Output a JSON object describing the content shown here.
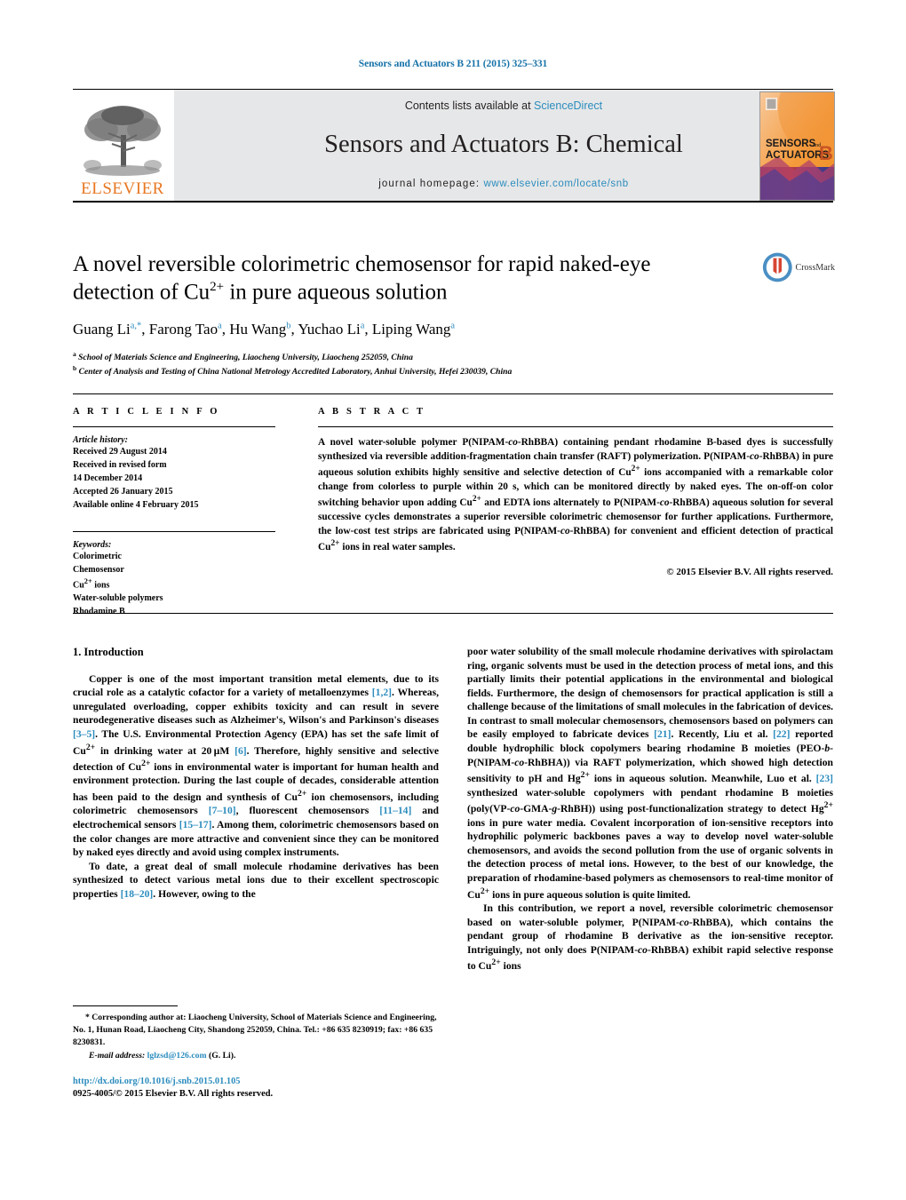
{
  "running_head": "Sensors and Actuators B 211 (2015) 325–331",
  "masthead": {
    "contents_prefix": "Contents lists available at ",
    "sciencedirect": "ScienceDirect",
    "journal_title": "Sensors and Actuators B: Chemical",
    "homepage_prefix": "journal homepage: ",
    "homepage_url": "www.elsevier.com/locate/snb",
    "publisher": "ELSEVIER",
    "cover_line1": "SENSORS",
    "cover_and": "and",
    "cover_line2": "ACTUATORS",
    "cover_letter": "B",
    "accent_color": "#2b8cbe",
    "elsevier_orange": "#E87722"
  },
  "crossmark": {
    "label": "CrossMark"
  },
  "title": {
    "line1": "A novel reversible colorimetric chemosensor for rapid naked-eye",
    "line2_pre": "detection of Cu",
    "line2_sup": "2+",
    "line2_post": " in pure aqueous solution"
  },
  "authors": {
    "list": "Guang Li a,*, Farong Tao a, Hu Wang b, Yuchao Li a, Liping Wang a",
    "affiliation_a": "School of Materials Science and Engineering, Liaocheng University, Liaocheng 252059, China",
    "affiliation_b": "Center of Analysis and Testing of China National Metrology Accredited Laboratory, Anhui University, Hefei 230039, China"
  },
  "article_info": {
    "heading": "A R T I C L E   I N F O",
    "history_label": "Article history:",
    "history": [
      "Received 29 August 2014",
      "Received in revised form",
      "14 December 2014",
      "Accepted 26 January 2015",
      "Available online 4 February 2015"
    ],
    "keywords_label": "Keywords:",
    "keywords": [
      "Colorimetric",
      "Chemosensor",
      "Cu2+ ions",
      "Water-soluble polymers",
      "Rhodamine B"
    ]
  },
  "abstract": {
    "heading": "A B S T R A C T",
    "text": "A novel water-soluble polymer P(NIPAM-co-RhBBA) containing pendant rhodamine B-based dyes is successfully synthesized via reversible addition-fragmentation chain transfer (RAFT) polymerization. P(NIPAM-co-RhBBA) in pure aqueous solution exhibits highly sensitive and selective detection of Cu2+ ions accompanied with a remarkable color change from colorless to purple within 20 s, which can be monitored directly by naked eyes. The on-off-on color switching behavior upon adding Cu2+ and EDTA ions alternately to P(NIPAM-co-RhBBA) aqueous solution for several successive cycles demonstrates a superior reversible colorimetric chemosensor for further applications. Furthermore, the low-cost test strips are fabricated using P(NIPAM-co-RhBBA) for convenient and efficient detection of practical Cu2+ ions in real water samples.",
    "copyright": "© 2015 Elsevier B.V. All rights reserved."
  },
  "body": {
    "section_heading": "1.  Introduction",
    "left_paragraph_1": "Copper is one of the most important transition metal elements, due to its crucial role as a catalytic cofactor for a variety of metalloenzymes [1,2]. Whereas, unregulated overloading, copper exhibits toxicity and can result in severe neurodegenerative diseases such as Alzheimer's, Wilson's and Parkinson's diseases [3–5]. The U.S. Environmental Protection Agency (EPA) has set the safe limit of Cu2+ in drinking water at 20 μM [6]. Therefore, highly sensitive and selective detection of Cu2+ ions in environmental water is important for human health and environment protection. During the last couple of decades, considerable attention has been paid to the design and synthesis of Cu2+ ion chemosensors, including colorimetric chemosensors [7–10], fluorescent chemosensors [11–14] and electrochemical sensors [15–17]. Among them, colorimetric chemosensors based on the color changes are more attractive and convenient since they can be monitored by naked eyes directly and avoid using complex instruments.",
    "left_paragraph_2": "To date, a great deal of small molecule rhodamine derivatives has been synthesized to detect various metal ions due to their excellent spectroscopic properties [18–20]. However, owing to the",
    "right_paragraph_1": "poor water solubility of the small molecule rhodamine derivatives with spirolactam ring, organic solvents must be used in the detection process of metal ions, and this partially limits their potential applications in the environmental and biological fields. Furthermore, the design of chemosensors for practical application is still a challenge because of the limitations of small molecules in the fabrication of devices. In contrast to small molecular chemosensors, chemosensors based on polymers can be easily employed to fabricate devices [21]. Recently, Liu et al. [22] reported double hydrophilic block copolymers bearing rhodamine B moieties (PEO-b-P(NIPAM-co-RhBHA)) via RAFT polymerization, which showed high detection sensitivity to pH and Hg2+ ions in aqueous solution. Meanwhile, Luo et al. [23] synthesized water-soluble copolymers with pendant rhodamine B moieties (poly(VP-co-GMA-g-RhBH)) using post-functionalization strategy to detect Hg2+ ions in pure water media. Covalent incorporation of ion-sensitive receptors into hydrophilic polymeric backbones paves a way to develop novel water-soluble chemosensors, and avoids the second pollution from the use of organic solvents in the detection process of metal ions. However, to the best of our knowledge, the preparation of rhodamine-based polymers as chemosensors to real-time monitor of Cu2+ ions in pure aqueous solution is quite limited.",
    "right_paragraph_2": "In this contribution, we report a novel, reversible colorimetric chemosensor based on water-soluble polymer, P(NIPAM-co-RhBBA), which contains the pendant group of rhodamine B derivative as the ion-sensitive receptor. Intriguingly, not only does P(NIPAM-co-RhBBA) exhibit rapid selective response to Cu2+ ions"
  },
  "footnote": {
    "corresponding": "* Corresponding author at: Liaocheng University, School of Materials Science and Engineering, No. 1, Hunan Road, Liaocheng City, Shandong 252059,",
    "contact": "China. Tel.: +86 635 8230919; fax: +86 635 8230831.",
    "email_label": "E-mail address:",
    "email": "lglzsd@126.com",
    "email_suffix": "(G. Li)."
  },
  "imprint": {
    "doi": "http://dx.doi.org/10.1016/j.snb.2015.01.105",
    "issn": "0925-4005/© 2015 Elsevier B.V. All rights reserved."
  }
}
